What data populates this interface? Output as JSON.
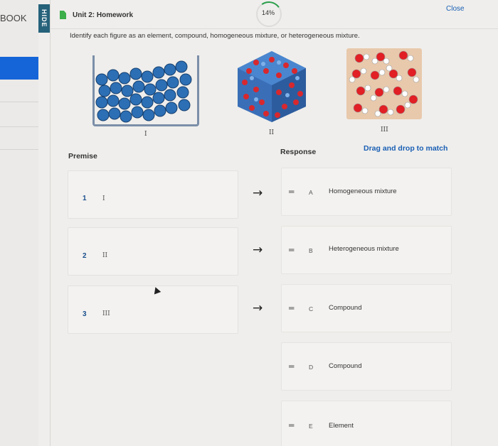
{
  "sidebar": {
    "book_label": "BOOK",
    "hide_label": "HIDE"
  },
  "header": {
    "title": "Unit 2: Homework",
    "progress": "14%",
    "progress_value": 0.14,
    "close_label": "Close"
  },
  "question": "Identify each figure as an element, compound, homogeneous mixture, or heterogeneous mixture.",
  "figures": [
    {
      "label": "I",
      "icon": "beaker-blue-particles-image"
    },
    {
      "label": "II",
      "icon": "cube-red-blue-particles-image"
    },
    {
      "label": "III",
      "icon": "box-red-white-molecules-image"
    }
  ],
  "columns": {
    "premise": "Premise",
    "response": "Response",
    "instruction": "Drag and drop to match"
  },
  "premises": [
    {
      "num": "1",
      "text": "I"
    },
    {
      "num": "2",
      "text": "II"
    },
    {
      "num": "3",
      "text": "III"
    }
  ],
  "responses": [
    {
      "letter": "A",
      "label": "Homogeneous mixture"
    },
    {
      "letter": "B",
      "label": "Heterogeneous mixture"
    },
    {
      "letter": "C",
      "label": "Compound"
    },
    {
      "letter": "D",
      "label": "Compound"
    },
    {
      "letter": "E",
      "label": "Element"
    }
  ],
  "colors": {
    "accent": "#1a5fb4",
    "sidebar_active": "#1565d8",
    "hide_tab": "#26627a",
    "progress": "#2a9f4a"
  }
}
